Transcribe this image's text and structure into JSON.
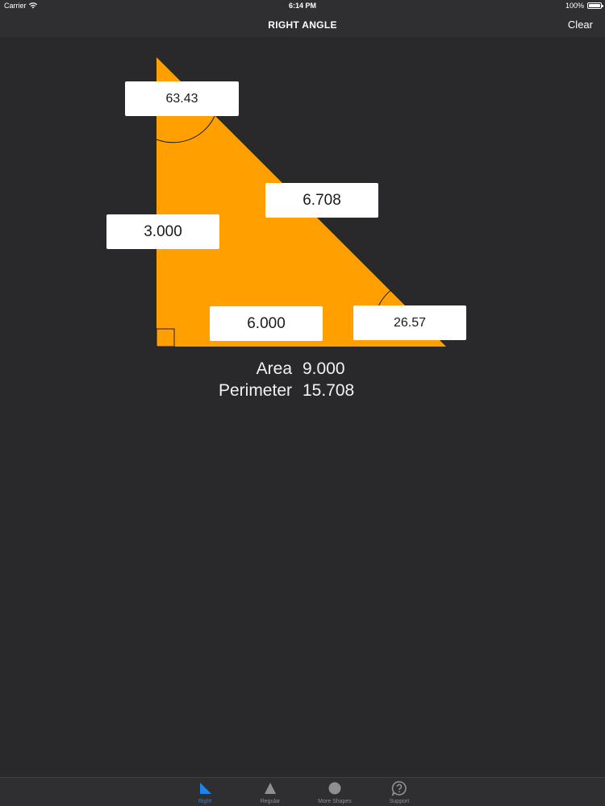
{
  "status_bar": {
    "carrier": "Carrier",
    "time": "6:14 PM",
    "battery": "100%"
  },
  "nav": {
    "title": "RIGHT ANGLE",
    "clear_label": "Clear"
  },
  "triangle": {
    "fill_color": "#ffa000",
    "top_angle": "63.43",
    "hypotenuse": "6.708",
    "vertical_side": "3.000",
    "base": "6.000",
    "bottom_angle": "26.57"
  },
  "results": {
    "area_label": "Area",
    "area_value": "9.000",
    "perimeter_label": "Perimeter",
    "perimeter_value": "15.708"
  },
  "tabs": [
    {
      "label": "Right",
      "icon": "right-triangle-icon",
      "active": true
    },
    {
      "label": "Regular",
      "icon": "triangle-icon",
      "active": false
    },
    {
      "label": "More Shapes",
      "icon": "circle-icon",
      "active": false
    },
    {
      "label": "Support",
      "icon": "support-bubble-icon",
      "active": false
    }
  ],
  "colors": {
    "background": "#29292b",
    "bar": "#2f2f31",
    "accent": "#1a84f0",
    "triangle": "#ffa000"
  }
}
